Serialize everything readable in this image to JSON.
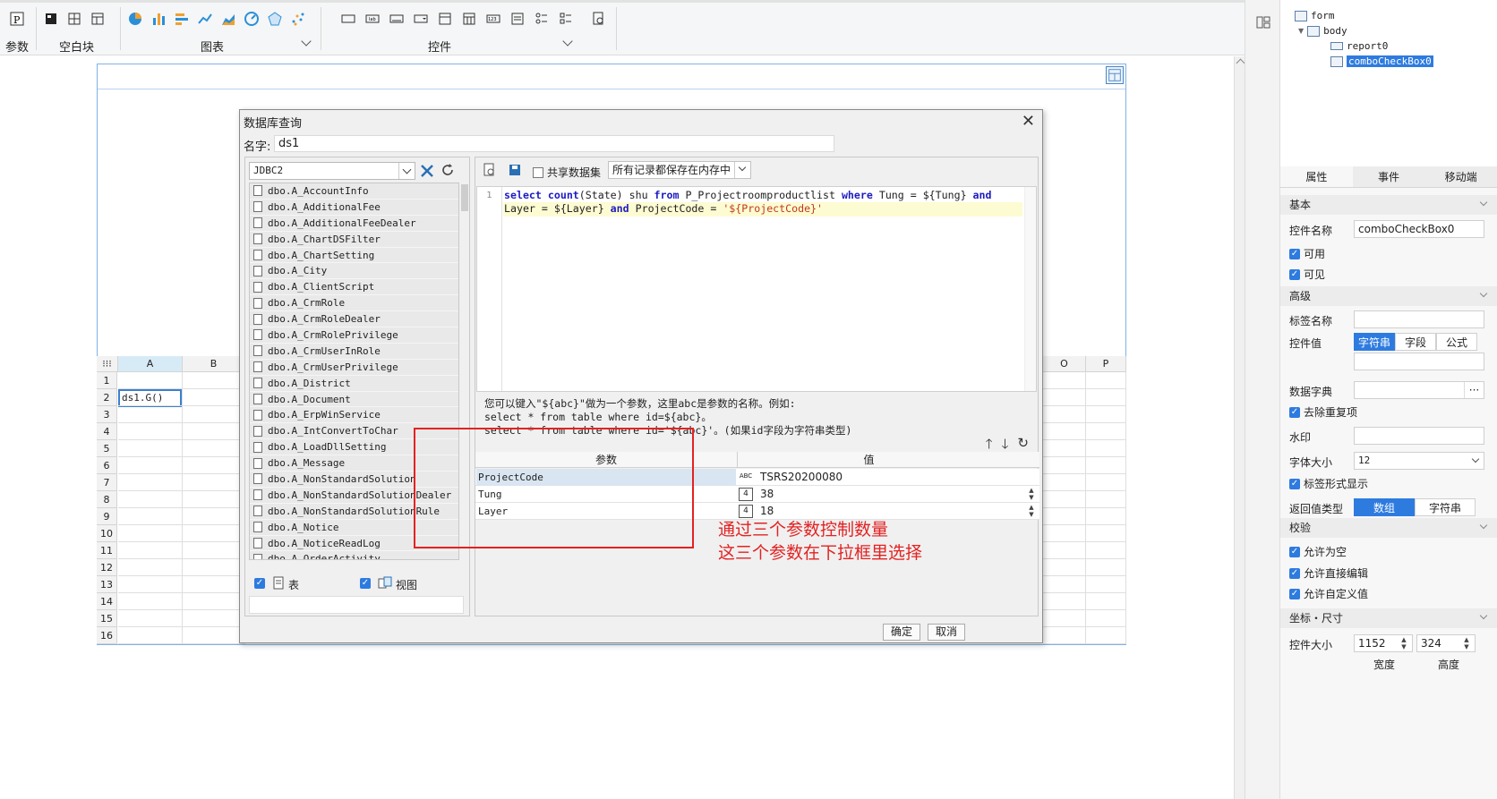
{
  "toolbar": {
    "param_label": "参数",
    "blank_label": "空白块",
    "chart_label": "图表",
    "control_label": "控件"
  },
  "sheet": {
    "columns": [
      "A",
      "B",
      "O",
      "P"
    ],
    "rows": [
      "1",
      "2",
      "3",
      "4",
      "5",
      "6",
      "7",
      "8",
      "9",
      "10",
      "11",
      "12",
      "13",
      "14",
      "15",
      "16"
    ],
    "cell_a2": "ds1.G()"
  },
  "tree": {
    "form": "form",
    "body": "body",
    "report": "report0",
    "combo": "comboCheckBox0"
  },
  "props": {
    "tabs": [
      "属性",
      "事件",
      "移动端"
    ],
    "sec_basic": "基本",
    "name_label": "控件名称",
    "name_value": "comboCheckBox0",
    "enabled": "可用",
    "visible": "可见",
    "sec_advanced": "高级",
    "tag_name": "标签名称",
    "control_value": "控件值",
    "value_types": [
      "字符串",
      "字段",
      "公式"
    ],
    "dict": "数据字典",
    "dict_btn": "···",
    "dedupe": "去除重复项",
    "watermark": "水印",
    "font_size_label": "字体大小",
    "font_size": "12",
    "tag_display": "标签形式显示",
    "return_type": "返回值类型",
    "return_opts": [
      "数组",
      "字符串"
    ],
    "sec_check": "校验",
    "allow_empty": "允许为空",
    "allow_edit": "允许直接编辑",
    "allow_custom": "允许自定义值",
    "sec_coord": "坐标・尺寸",
    "size_label": "控件大小",
    "width": "1152",
    "height": "324",
    "width_label": "宽度",
    "height_label": "高度"
  },
  "dialog": {
    "title": "数据库查询",
    "name_label": "名字:",
    "name_value": "ds1",
    "connection": "JDBC2",
    "tables": [
      "dbo.A_AccountInfo",
      "dbo.A_AdditionalFee",
      "dbo.A_AdditionalFeeDealer",
      "dbo.A_ChartDSFilter",
      "dbo.A_ChartSetting",
      "dbo.A_City",
      "dbo.A_ClientScript",
      "dbo.A_CrmRole",
      "dbo.A_CrmRoleDealer",
      "dbo.A_CrmRolePrivilege",
      "dbo.A_CrmUserInRole",
      "dbo.A_CrmUserPrivilege",
      "dbo.A_District",
      "dbo.A_Document",
      "dbo.A_ErpWinService",
      "dbo.A_IntConvertToChar",
      "dbo.A_LoadDllSetting",
      "dbo.A_Message",
      "dbo.A_NonStandardSolution",
      "dbo.A_NonStandardSolutionDealer",
      "dbo.A_NonStandardSolutionRule",
      "dbo.A_Notice",
      "dbo.A_NoticeReadLog",
      "dbo.A_OrderActivity"
    ],
    "opt_table": "表",
    "opt_view": "视图",
    "share_label": "共享数据集",
    "memory_select": "所有记录都保存在内存中",
    "sql_line_no": "1",
    "help_line1": "您可以键入\"${abc}\"做为一个参数，这里abc是参数的名称。例如:",
    "help_line2": "select * from table where id=${abc}。",
    "help_line3": "select * from table where id='${abc}'。(如果id字段为字符串类型)",
    "param_header": "参数",
    "value_header": "值",
    "params": [
      {
        "name": "ProjectCode",
        "type": "ABC",
        "value": "TSRS20200080"
      },
      {
        "name": "Tung",
        "type": "4",
        "value": "38"
      },
      {
        "name": "Layer",
        "type": "4",
        "value": "18"
      }
    ],
    "ok": "确定",
    "cancel": "取消"
  },
  "annotation": {
    "line1": "通过三个参数控制数量",
    "line2": "这三个参数在下拉框里选择"
  },
  "colors": {
    "accent": "#2e7be0",
    "annotation": "#e32222",
    "keyword": "#1c1cc2",
    "string": "#c23a1c"
  }
}
